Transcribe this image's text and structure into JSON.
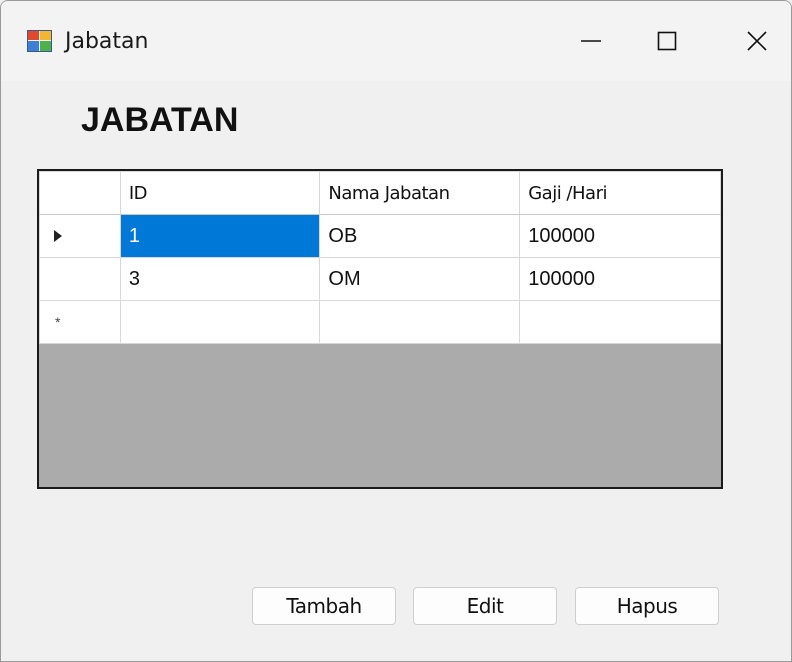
{
  "window": {
    "title": "Jabatan",
    "minimize_glyph": "—",
    "close_glyph": "✕"
  },
  "heading": "JABATAN",
  "grid": {
    "columns": [
      "ID",
      "Nama Jabatan",
      "Gaji /Hari"
    ],
    "rows": [
      {
        "id": "1",
        "nama": "OB",
        "gaji": "100000",
        "indicator": "current-row-arrow",
        "selected_cell": "id"
      },
      {
        "id": "3",
        "nama": "OM",
        "gaji": "100000"
      }
    ],
    "new_row_marker": "*"
  },
  "buttons": {
    "tambah": "Tambah",
    "edit": "Edit",
    "hapus": "Hapus"
  },
  "colors": {
    "selection": "#0078d7",
    "grid_background": "#ababab",
    "window_background": "#f0f0f0"
  }
}
